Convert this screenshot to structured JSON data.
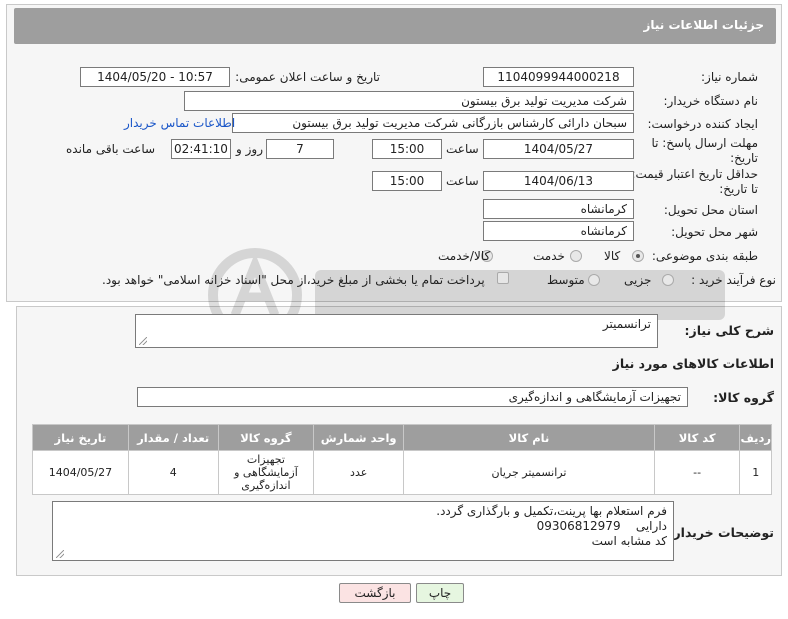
{
  "header": {
    "title": "جزئیات اطلاعات نیاز"
  },
  "form": {
    "need_number": {
      "label": "شماره نیاز:",
      "value": "1104099944000218"
    },
    "announce_datetime": {
      "label": "تاریخ و ساعت اعلان عمومی:",
      "value": "1404/05/20 - 10:57"
    },
    "buyer_org": {
      "label": "نام دستگاه خریدار:",
      "value": "شرکت مدیریت تولید برق بیستون"
    },
    "creator": {
      "label": "ایجاد کننده درخواست:",
      "value": "سبحان دارائی کارشناس بازرگانی شرکت مدیریت تولید برق بیستون",
      "contact_link": "اطلاعات تماس خریدار"
    },
    "reply_deadline": {
      "label_line1": "مهلت ارسال پاسخ: تا",
      "label_line2": "تاریخ:",
      "date": "1404/05/27",
      "time_label": "ساعت",
      "time": "15:00",
      "days": "7",
      "days_label": "روز و",
      "remaining": "02:41:10",
      "remaining_label": "ساعت باقی مانده"
    },
    "price_validity": {
      "label_line1": "حداقل تاریخ اعتبار قیمت:",
      "label_line2": "تا تاریخ:",
      "date": "1404/06/13",
      "time_label": "ساعت",
      "time": "15:00"
    },
    "delivery_province": {
      "label": "استان محل تحویل:",
      "value": "کرمانشاه"
    },
    "delivery_city": {
      "label": "شهر محل تحویل:",
      "value": "کرمانشاه"
    },
    "category": {
      "label": "طبقه بندی موضوعی:",
      "options": [
        "کالا",
        "خدمت",
        "کالا/خدمت"
      ],
      "selected": "کالا"
    },
    "purchase_type": {
      "label": "نوع فرآیند خرید :",
      "options": [
        "جزیی",
        "متوسط"
      ],
      "selected": "جزیی",
      "payment_note": "پرداخت تمام یا بخشی از مبلغ خرید،از محل \"اسناد خزانه اسلامی\" خواهد بود."
    }
  },
  "details": {
    "summary_label": "شرح کلی نیاز:",
    "summary_value": "ترانسمیتر",
    "goods_info_title": "اطلاعات کالاهای مورد نیاز",
    "goods_group_label": "گروه کالا:",
    "goods_group_value": "تجهیزات آزمایشگاهی و اندازه‌گیری",
    "table": {
      "headers": [
        "ردیف",
        "کد کالا",
        "نام کالا",
        "واحد شمارش",
        "گروه کالا",
        "تعداد / مقدار",
        "تاریخ نیاز"
      ],
      "rows": [
        {
          "row": "1",
          "code": "--",
          "name": "ترانسمیتر جریان",
          "unit": "عدد",
          "group_l1": "تجهیزات",
          "group_l2": "آزمایشگاهی و",
          "group_l3": "اندازه‌گیری",
          "qty": "4",
          "date": "1404/05/27"
        }
      ]
    },
    "buyer_notes_label": "توضیحات خریدار:",
    "buyer_notes": {
      "line1": "فرم استعلام بها پرینت،تکمیل و بارگذاری گردد.",
      "line2_phone": "09306812979",
      "line2_name": "دارایی",
      "line3": "کد مشابه است"
    }
  },
  "buttons": {
    "print": "چاپ",
    "back": "بازگشت"
  },
  "colors": {
    "header_bg": "#9e9e9e",
    "link": "#1a56c8",
    "back_bg": "#fbe3e3",
    "print_bg": "#e6f6e0"
  }
}
